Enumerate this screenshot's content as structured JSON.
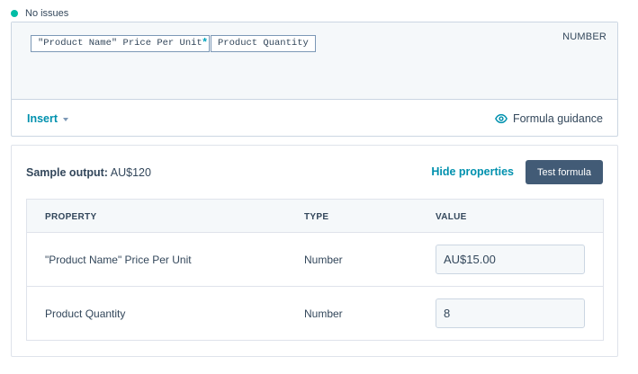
{
  "status": {
    "text": "No issues",
    "color": "#00bda5"
  },
  "editor": {
    "tokens": [
      "\"Product Name\" Price Per Unit",
      "Product Quantity"
    ],
    "operator": "*",
    "type_badge": "NUMBER",
    "insert_label": "Insert",
    "guidance_label": "Formula guidance"
  },
  "panel": {
    "sample_label": "Sample output:",
    "sample_value": "AU$120",
    "hide_properties_label": "Hide properties",
    "test_button_label": "Test formula",
    "table": {
      "headers": {
        "property": "PROPERTY",
        "type": "TYPE",
        "value": "VALUE"
      },
      "rows": [
        {
          "property": "\"Product Name\" Price Per Unit",
          "type": "Number",
          "value": "AU$15.00"
        },
        {
          "property": "Product Quantity",
          "type": "Number",
          "value": "8"
        }
      ]
    }
  },
  "colors": {
    "accent": "#0091ae",
    "button": "#425b76",
    "text": "#33475b"
  },
  "icons": {
    "status": "status-dot-icon",
    "insert": "chevron-down-icon",
    "guidance": "eye-icon"
  }
}
